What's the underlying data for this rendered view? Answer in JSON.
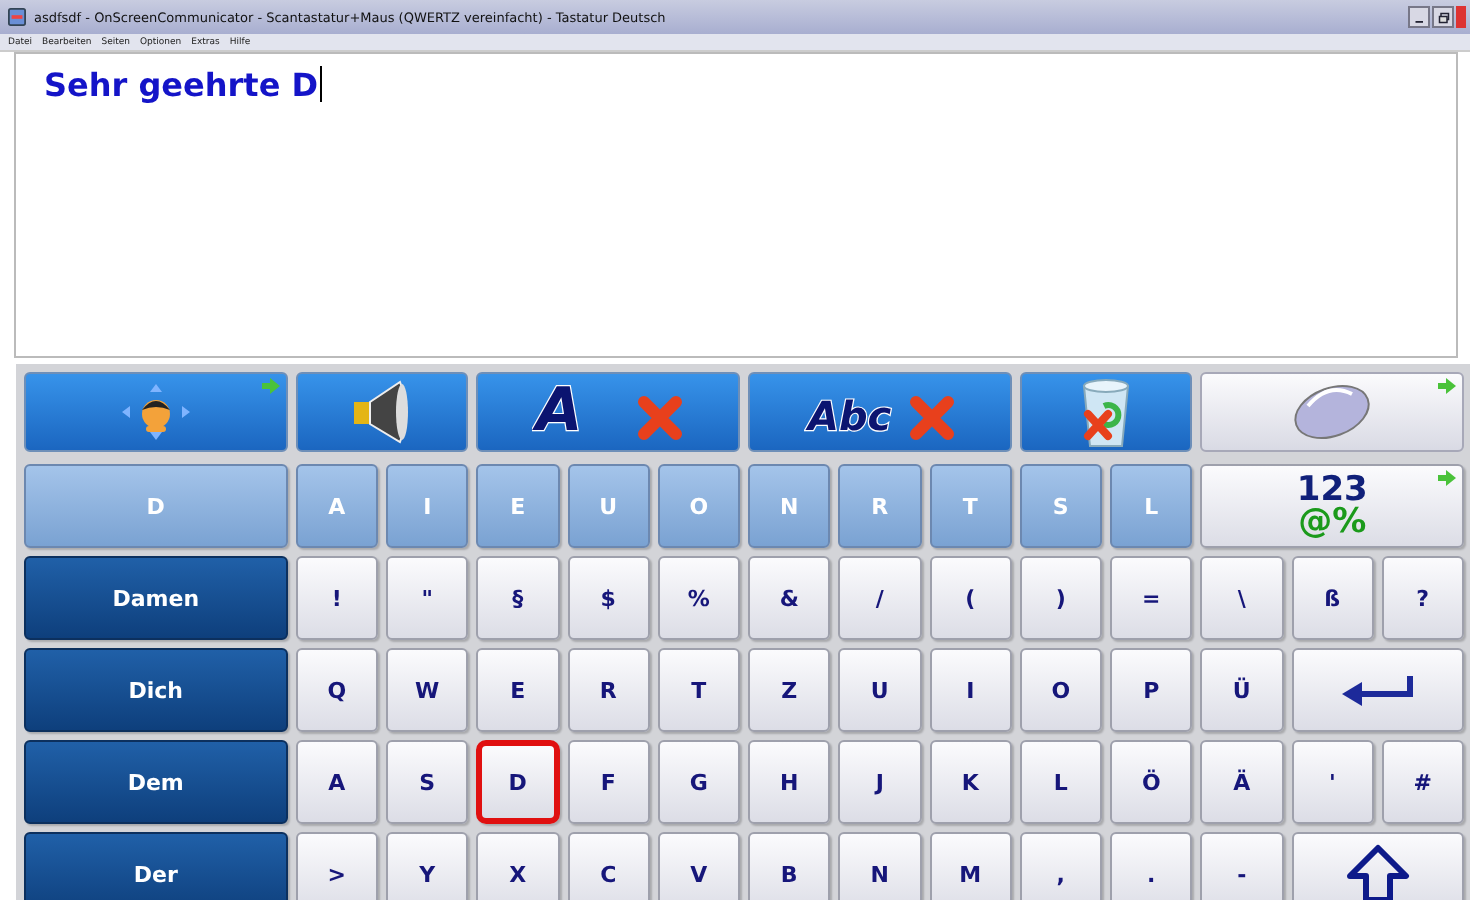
{
  "window": {
    "title": "asdfsdf - OnScreenCommunicator - Scantastatur+Maus (QWERTZ vereinfacht) - Tastatur Deutsch"
  },
  "menu": [
    "Datei",
    "Bearbeiten",
    "Seiten",
    "Optionen",
    "Extras",
    "Hilfe"
  ],
  "editor": {
    "value": "Sehr geehrte D"
  },
  "toolbar": [
    {
      "kind": "move"
    },
    {
      "kind": "speak"
    },
    {
      "kind": "clear_letter",
      "label": "A"
    },
    {
      "kind": "clear_word",
      "label": "Abc"
    },
    {
      "kind": "trash"
    },
    {
      "kind": "mouse"
    }
  ],
  "rows": [
    [
      {
        "kind": "light_word",
        "label": "D",
        "selected": false
      },
      {
        "kind": "light",
        "label": "A",
        "selected": false
      },
      {
        "kind": "light",
        "label": "I",
        "selected": false
      },
      {
        "kind": "light",
        "label": "E",
        "selected": false
      },
      {
        "kind": "light",
        "label": "U",
        "selected": false
      },
      {
        "kind": "light",
        "label": "O",
        "selected": false
      },
      {
        "kind": "light",
        "label": "N",
        "selected": false
      },
      {
        "kind": "light",
        "label": "R",
        "selected": false
      },
      {
        "kind": "light",
        "label": "T",
        "selected": false
      },
      {
        "kind": "light",
        "label": "S",
        "selected": false
      },
      {
        "kind": "light",
        "label": "L",
        "selected": false
      },
      {
        "kind": "mode",
        "label": "123",
        "label2": "@%",
        "selected": false
      }
    ],
    [
      {
        "kind": "word",
        "label": "Damen",
        "selected": false
      },
      {
        "kind": "char",
        "label": "!",
        "selected": false
      },
      {
        "kind": "char",
        "label": "\"",
        "selected": false
      },
      {
        "kind": "char",
        "label": "§",
        "selected": false
      },
      {
        "kind": "char",
        "label": "$",
        "selected": false
      },
      {
        "kind": "char",
        "label": "%",
        "selected": false
      },
      {
        "kind": "char",
        "label": "&",
        "selected": false
      },
      {
        "kind": "char",
        "label": "/",
        "selected": false
      },
      {
        "kind": "char",
        "label": "(",
        "selected": false
      },
      {
        "kind": "char",
        "label": ")",
        "selected": false
      },
      {
        "kind": "char",
        "label": "=",
        "selected": false
      },
      {
        "kind": "char",
        "label": "\\",
        "selected": false
      },
      {
        "kind": "char",
        "label": "ß",
        "selected": false
      },
      {
        "kind": "char",
        "label": "?",
        "selected": false
      }
    ],
    [
      {
        "kind": "word",
        "label": "Dich",
        "selected": false
      },
      {
        "kind": "char",
        "label": "Q",
        "selected": false
      },
      {
        "kind": "char",
        "label": "W",
        "selected": false
      },
      {
        "kind": "char",
        "label": "E",
        "selected": false
      },
      {
        "kind": "char",
        "label": "R",
        "selected": false
      },
      {
        "kind": "char",
        "label": "T",
        "selected": false
      },
      {
        "kind": "char",
        "label": "Z",
        "selected": false
      },
      {
        "kind": "char",
        "label": "U",
        "selected": false
      },
      {
        "kind": "char",
        "label": "I",
        "selected": false
      },
      {
        "kind": "char",
        "label": "O",
        "selected": false
      },
      {
        "kind": "char",
        "label": "P",
        "selected": false
      },
      {
        "kind": "char",
        "label": "Ü",
        "selected": false
      },
      {
        "kind": "enter",
        "selected": false
      }
    ],
    [
      {
        "kind": "word",
        "label": "Dem",
        "selected": false
      },
      {
        "kind": "char",
        "label": "A",
        "selected": false
      },
      {
        "kind": "char",
        "label": "S",
        "selected": false
      },
      {
        "kind": "char",
        "label": "D",
        "selected": true
      },
      {
        "kind": "char",
        "label": "F",
        "selected": false
      },
      {
        "kind": "char",
        "label": "G",
        "selected": false
      },
      {
        "kind": "char",
        "label": "H",
        "selected": false
      },
      {
        "kind": "char",
        "label": "J",
        "selected": false
      },
      {
        "kind": "char",
        "label": "K",
        "selected": false
      },
      {
        "kind": "char",
        "label": "L",
        "selected": false
      },
      {
        "kind": "char",
        "label": "Ö",
        "selected": false
      },
      {
        "kind": "char",
        "label": "Ä",
        "selected": false
      },
      {
        "kind": "char",
        "label": "'",
        "selected": false
      },
      {
        "kind": "char",
        "label": "#",
        "selected": false
      }
    ],
    [
      {
        "kind": "word",
        "label": "Der",
        "selected": false
      },
      {
        "kind": "char",
        "label": ">",
        "selected": false
      },
      {
        "kind": "char",
        "label": "Y",
        "selected": false
      },
      {
        "kind": "char",
        "label": "X",
        "selected": false
      },
      {
        "kind": "char",
        "label": "C",
        "selected": false
      },
      {
        "kind": "char",
        "label": "V",
        "selected": false
      },
      {
        "kind": "char",
        "label": "B",
        "selected": false
      },
      {
        "kind": "char",
        "label": "N",
        "selected": false
      },
      {
        "kind": "char",
        "label": "M",
        "selected": false
      },
      {
        "kind": "char",
        "label": ",",
        "selected": false
      },
      {
        "kind": "char",
        "label": ".",
        "selected": false
      },
      {
        "kind": "char",
        "label": "-",
        "selected": false
      },
      {
        "kind": "shift",
        "selected": false
      }
    ]
  ]
}
